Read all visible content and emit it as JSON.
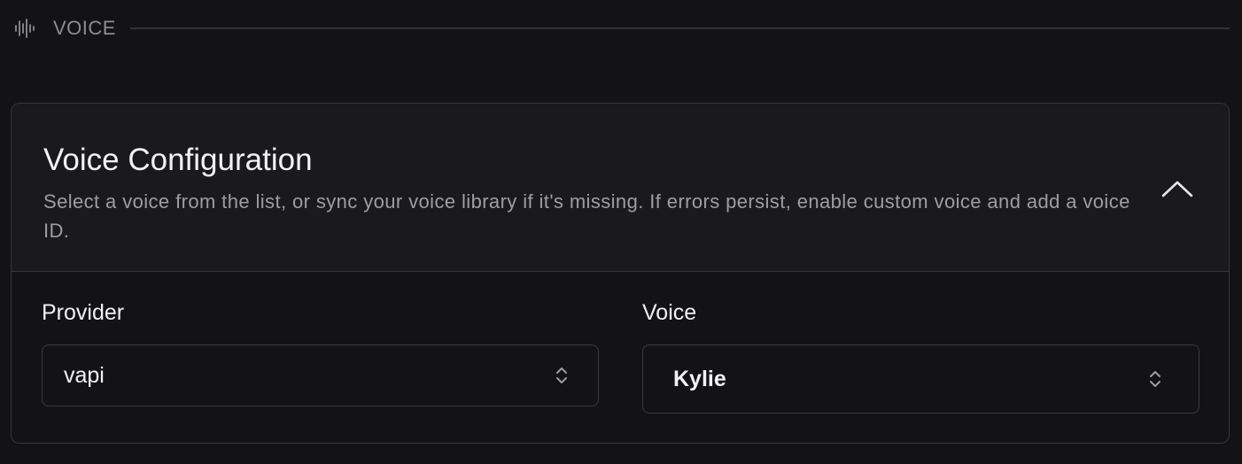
{
  "section": {
    "title": "VOICE",
    "icon": "waveform-icon"
  },
  "card": {
    "title": "Voice Configuration",
    "description": "Select a voice from the list, or sync your voice library if it's missing. If errors persist, enable custom voice and add a voice ID.",
    "collapse_icon": "chevron-up-icon"
  },
  "fields": {
    "provider": {
      "label": "Provider",
      "value": "vapi",
      "icon": "chevron-updown-icon"
    },
    "voice": {
      "label": "Voice",
      "value": "Kylie",
      "icon": "chevron-updown-icon"
    }
  },
  "colors": {
    "background": "#131315",
    "card_background": "#1a1a1d",
    "border": "#36363b",
    "muted_text": "#9d9da3"
  }
}
